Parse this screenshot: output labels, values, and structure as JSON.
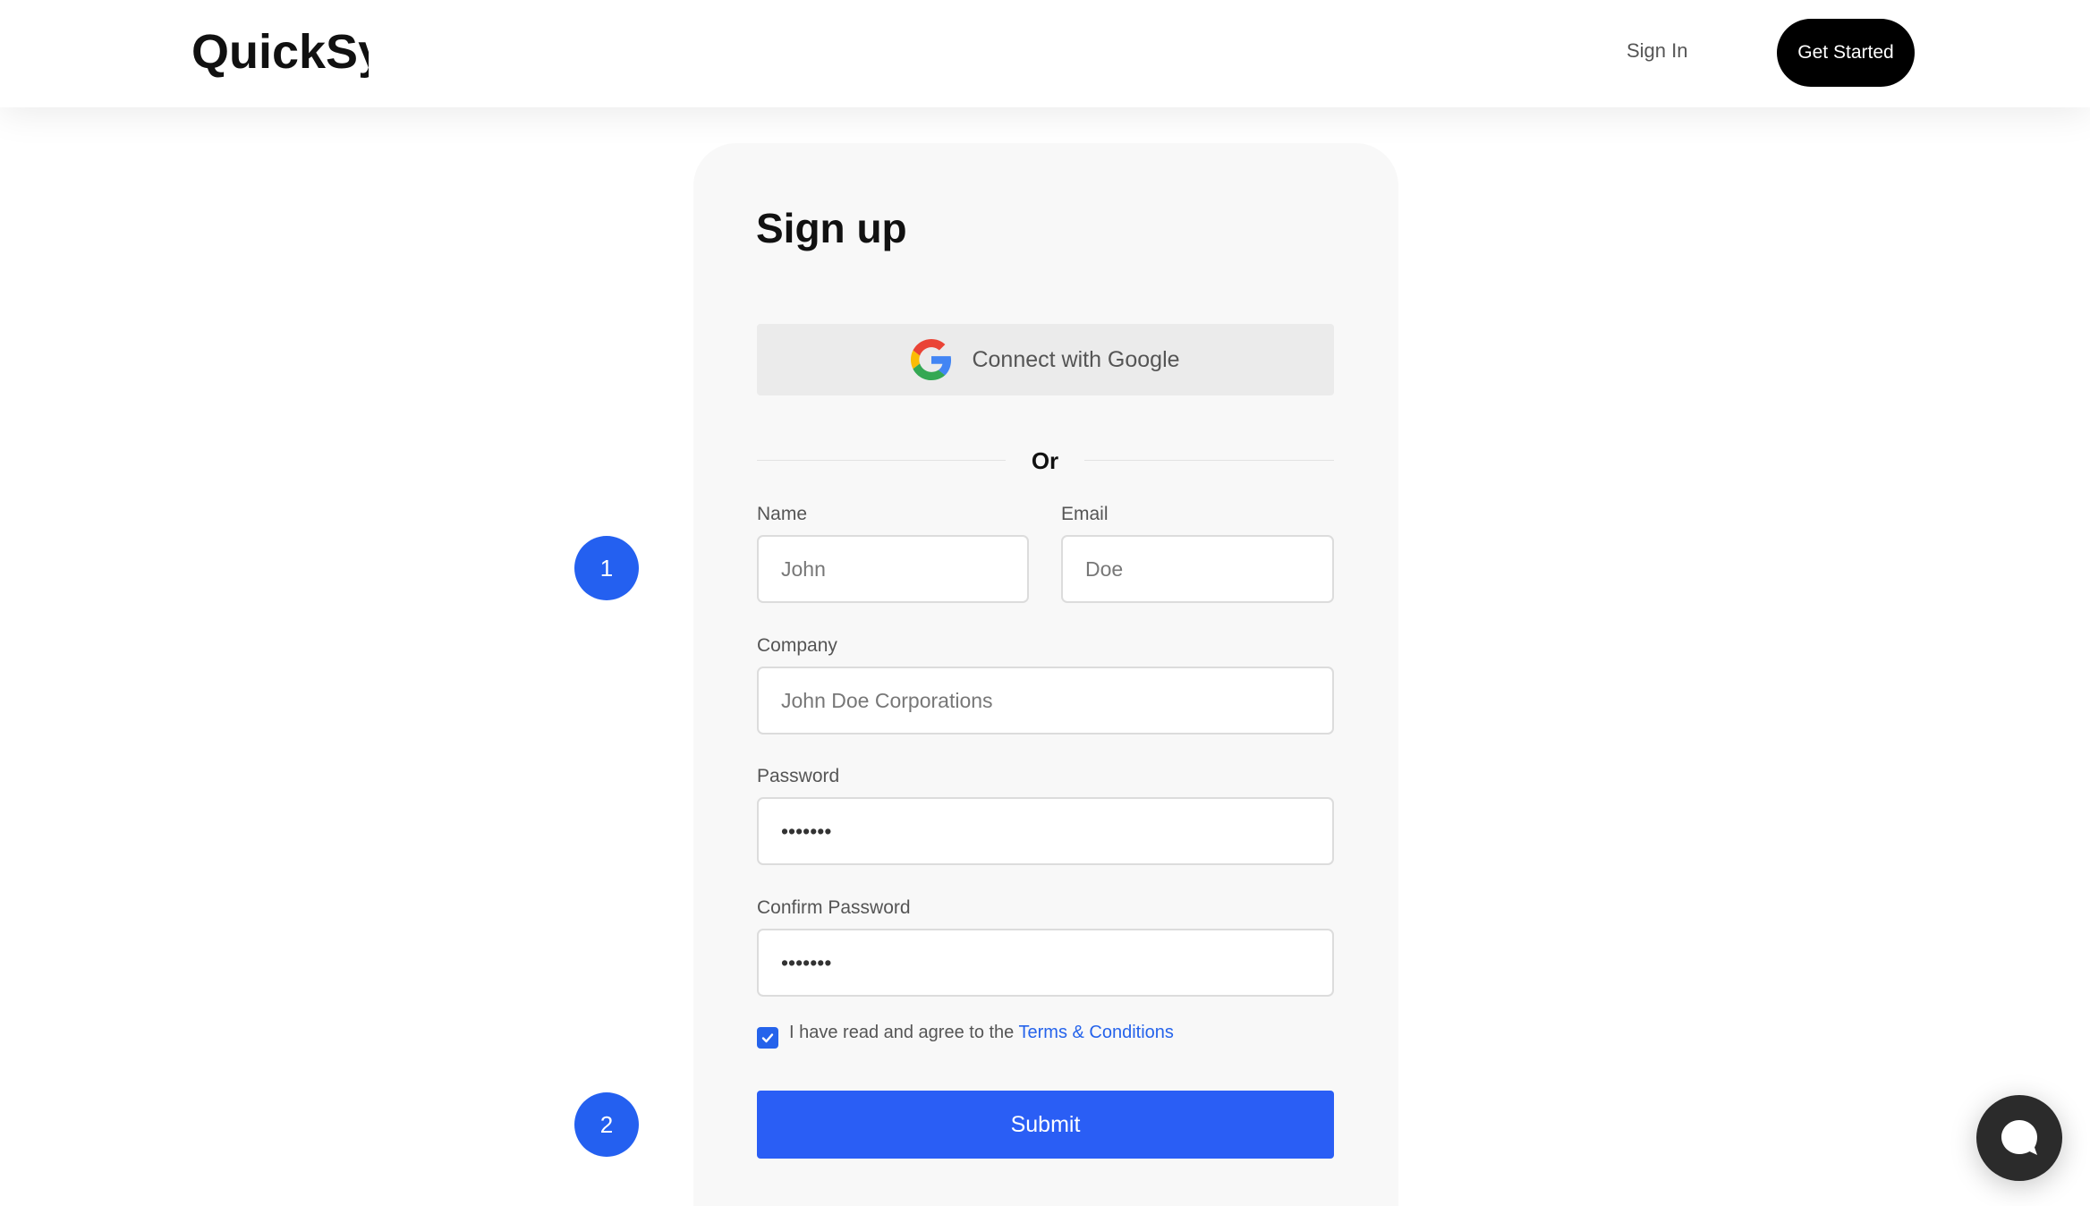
{
  "header": {
    "logo_text": "QuickSync",
    "signin_label": "Sign In",
    "get_started_label": "Get Started"
  },
  "form": {
    "title": "Sign up",
    "google_label": "Connect with Google",
    "divider_text": "Or",
    "name_label": "Name",
    "name_placeholder": "John",
    "email_label": "Email",
    "email_placeholder": "Doe",
    "company_label": "Company",
    "company_placeholder": "John Doe Corporations",
    "password_label": "Password",
    "password_value": "•••••••",
    "confirm_label": "Confirm Password",
    "confirm_value": "•••••••",
    "agree_text": "I have read and agree to the ",
    "terms_link": "Terms & Conditions",
    "agree_checked": true,
    "submit_label": "Submit"
  },
  "steps": [
    "1",
    "2"
  ],
  "icons": {
    "google": "google-g-icon",
    "check": "check-icon",
    "chat": "chat-bubble-icon"
  },
  "colors": {
    "accent": "#2a5ef5",
    "link": "#2563eb",
    "header_button": "#000000",
    "chat_button": "#2b2b2b",
    "card_bg": "#f8f8f8"
  }
}
